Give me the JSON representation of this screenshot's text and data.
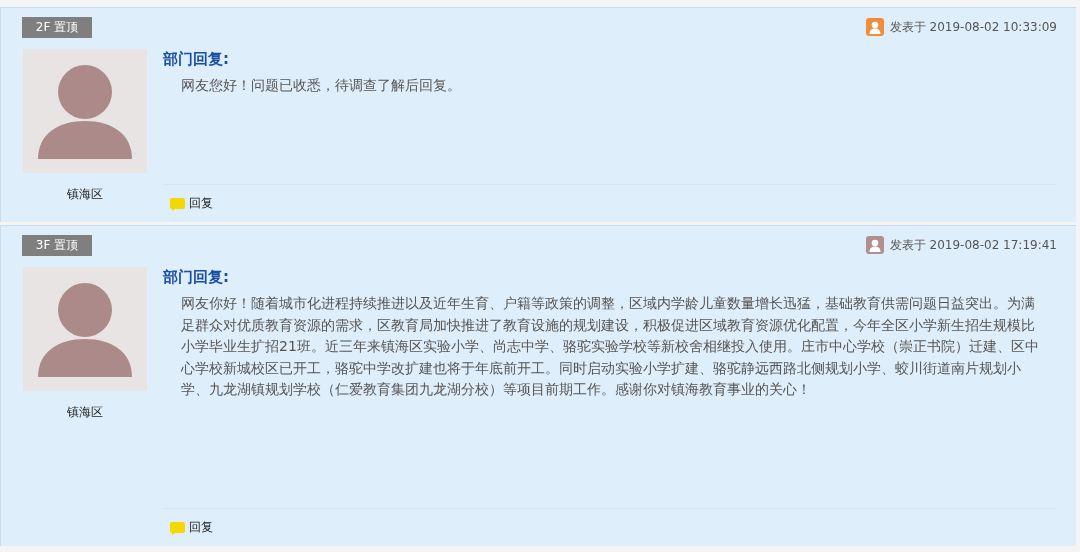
{
  "posts": [
    {
      "floor_tag": "2F 置顶",
      "posted_at": "发表于 2019-08-02 10:33:09",
      "color": "#f08c3c",
      "author": "镇海区",
      "reply_title": "部门回复:",
      "reply_body": "网友您好！问题已收悉，待调查了解后回复。",
      "reply_link": "回复"
    },
    {
      "floor_tag": "3F 置顶",
      "posted_at": "发表于 2019-08-02 17:19:41",
      "color": "#b08f8c",
      "author": "镇海区",
      "reply_title": "部门回复:",
      "reply_body": "网友你好！随着城市化进程持续推进以及近年生育、户籍等政策的调整，区域内学龄儿童数量增长迅猛，基础教育供需问题日益突出。为满足群众对优质教育资源的需求，区教育局加快推进了教育设施的规划建设，积极促进区域教育资源优化配置，今年全区小学新生招生规模比小学毕业生扩招21班。近三年来镇海区实验小学、尚志中学、骆驼实验学校等新校舍相继投入使用。庄市中心学校（崇正书院）迁建、区中心学校新城校区已开工，骆驼中学改扩建也将于年底前开工。同时启动实验小学扩建、骆驼静远西路北侧规划小学、蛟川街道南片规划小学、九龙湖镇规划学校（仁爱教育集团九龙湖分校）等项目前期工作。感谢你对镇海教育事业的关心！",
      "reply_link": "回复"
    }
  ]
}
